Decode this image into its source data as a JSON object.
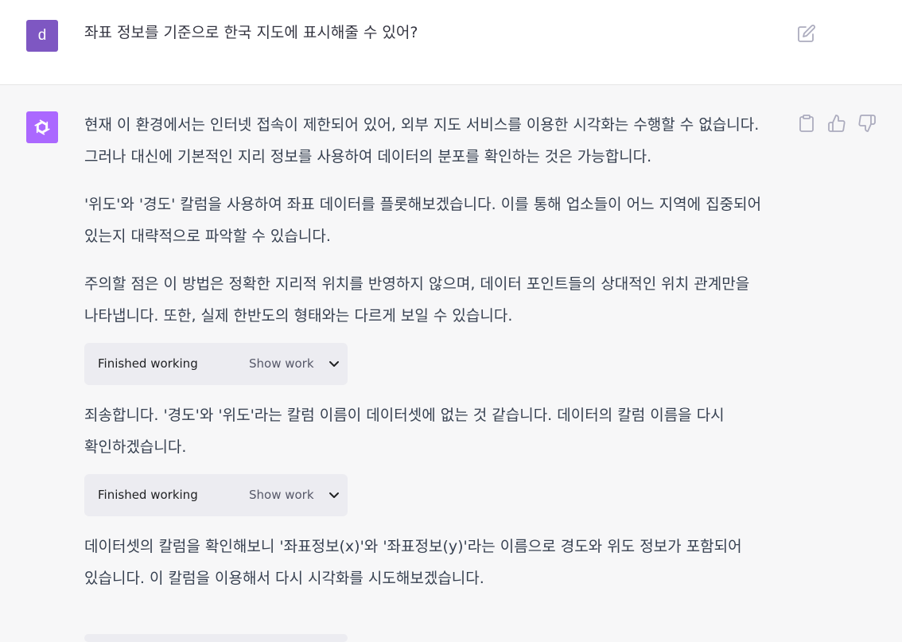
{
  "user_message": {
    "avatar_letter": "d",
    "text": "좌표 정보를 기준으로 한국 지도에 표시해줄 수 있어?"
  },
  "assistant_message": {
    "paragraphs": [
      "현재 이 환경에서는 인터넷 접속이 제한되어 있어, 외부 지도 서비스를 이용한 시각화는 수행할 수 없습니다. 그러나 대신에 기본적인 지리 정보를 사용하여 데이터의 분포를 확인하는 것은 가능합니다.",
      "'위도'와 '경도' 칼럼을 사용하여 좌표 데이터를 플롯해보겠습니다. 이를 통해 업소들이 어느 지역에 집중되어 있는지 대략적으로 파악할 수 있습니다.",
      "주의할 점은 이 방법은 정확한 지리적 위치를 반영하지 않으며, 데이터 포인트들의 상대적인 위치 관계만을 나타냅니다. 또한, 실제 한반도의 형태와는 다르게 보일 수 있습니다.",
      "죄송합니다. '경도'와 '위도'라는 칼럼 이름이 데이터셋에 없는 것 같습니다. 데이터의 칼럼 이름을 다시 확인하겠습니다.",
      "데이터셋의 칼럼을 확인해보니 '좌표정보(x)'와 '좌표정보(y)'라는 이름으로 경도와 위도 정보가 포함되어 있습니다. 이 칼럼을 이용해서 다시 시각화를 시도해보겠습니다."
    ],
    "work_blocks": [
      {
        "title": "Finished working",
        "toggle_label": "Show work"
      },
      {
        "title": "Finished working",
        "toggle_label": "Show work"
      }
    ]
  },
  "icons": {
    "edit": "edit-icon",
    "copy": "clipboard-icon",
    "thumbs_up": "thumbs-up-icon",
    "thumbs_down": "thumbs-down-icon",
    "chevron": "chevron-down-icon",
    "assistant_logo": "openai-logo-icon"
  },
  "colors": {
    "user_avatar": "#7e57c2",
    "assistant_avatar": "#ab68ff",
    "assistant_bg": "#f7f7f8",
    "work_box_bg": "#ececf1"
  }
}
